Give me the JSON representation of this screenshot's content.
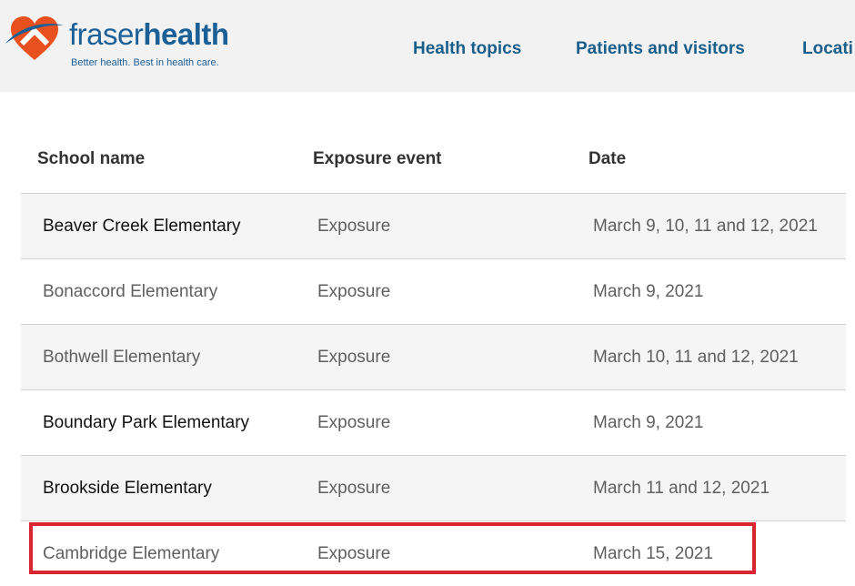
{
  "header": {
    "logo": {
      "word_light": "fraser",
      "word_bold": "health",
      "tagline": "Better health. Best in health care."
    },
    "nav": [
      {
        "label": "Health topics"
      },
      {
        "label": "Patients and visitors"
      },
      {
        "label": "Locati"
      }
    ]
  },
  "table": {
    "headers": [
      "School name",
      "Exposure event",
      "Date"
    ],
    "rows": [
      {
        "school": "Beaver Creek Elementary",
        "event": "Exposure",
        "date": "March 9, 10, 11 and 12, 2021"
      },
      {
        "school": "Bonaccord Elementary",
        "event": "Exposure",
        "date": "March 9, 2021"
      },
      {
        "school": "Bothwell Elementary",
        "event": "Exposure",
        "date": "March 10, 11 and 12, 2021"
      },
      {
        "school": "Boundary Park Elementary",
        "event": "Exposure",
        "date": "March 9, 2021"
      },
      {
        "school": "Brookside Elementary",
        "event": "Exposure",
        "date": "March 11 and 12, 2021"
      },
      {
        "school": "Cambridge Elementary",
        "event": "Exposure",
        "date": "March 15, 2021"
      }
    ]
  },
  "colors": {
    "brand_blue": "#1b5f97",
    "brand_orange": "#e8501e",
    "highlight_red": "#d9252f",
    "header_bg": "#f2f2f2"
  }
}
